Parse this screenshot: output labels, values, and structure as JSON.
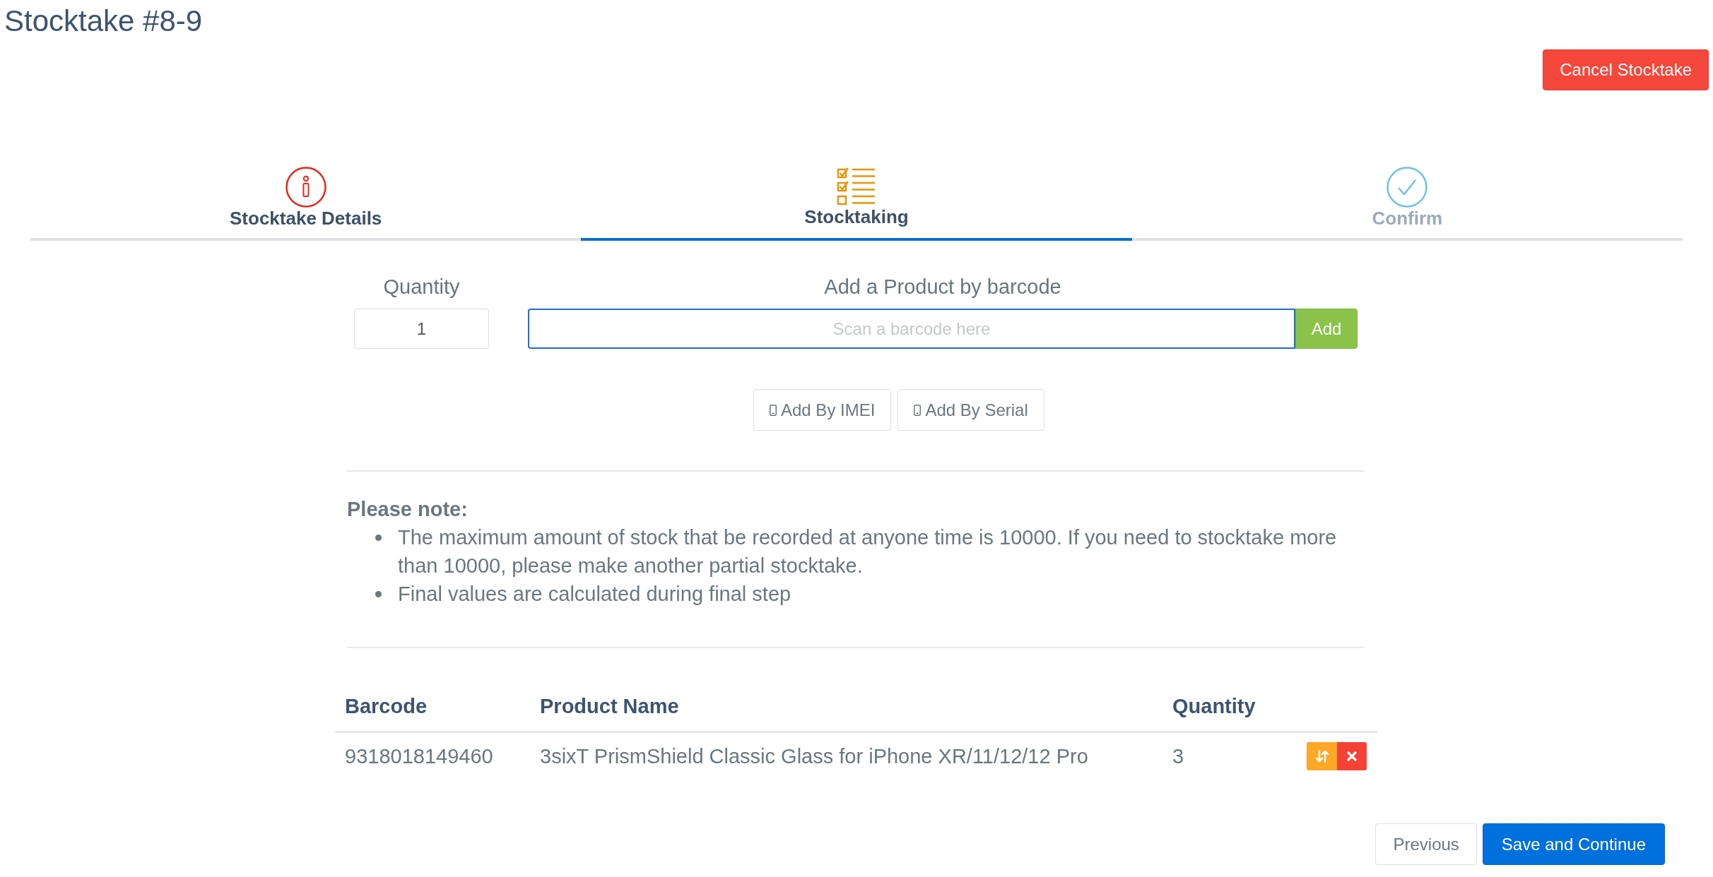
{
  "page": {
    "title": "Stocktake #8-9"
  },
  "header_buttons": [
    {
      "label": "Cancel Stocktake",
      "kind": "danger"
    }
  ],
  "steps": [
    {
      "label": "Stocktake Details",
      "kind": "info",
      "selected": false,
      "disabled": false
    },
    {
      "label": "Stocktaking",
      "kind": "checklist",
      "selected": true,
      "disabled": false
    },
    {
      "label": "Confirm",
      "kind": "confirm",
      "selected": false,
      "disabled": true
    }
  ],
  "quantity": {
    "label": "Quantity",
    "value": "1"
  },
  "barcode": {
    "label": "Add a Product by barcode",
    "placeholder": "Scan a barcode here",
    "focused": true,
    "button": "Add"
  },
  "add_by_buttons": [
    {
      "label": "Add By IMEI"
    },
    {
      "label": "Add By Serial"
    }
  ],
  "note": {
    "title": "Please note:",
    "items": [
      "The maximum amount of stock that be recorded at anyone time is 10000. If you need to stocktake more than 10000, please make another partial stocktake.",
      "Final values are calculated during final step"
    ]
  },
  "table": {
    "columns": [
      "Barcode",
      "Product Name",
      "Quantity"
    ],
    "rows": [
      {
        "barcode": "9318018149460",
        "product_name": "3sixT PrismShield Classic Glass for iPhone XR/11/12/12 Pro",
        "quantity": "3"
      }
    ]
  },
  "footer_buttons": [
    {
      "label": "Previous",
      "kind": "default"
    },
    {
      "label": "Save and Continue",
      "kind": "primary"
    }
  ]
}
